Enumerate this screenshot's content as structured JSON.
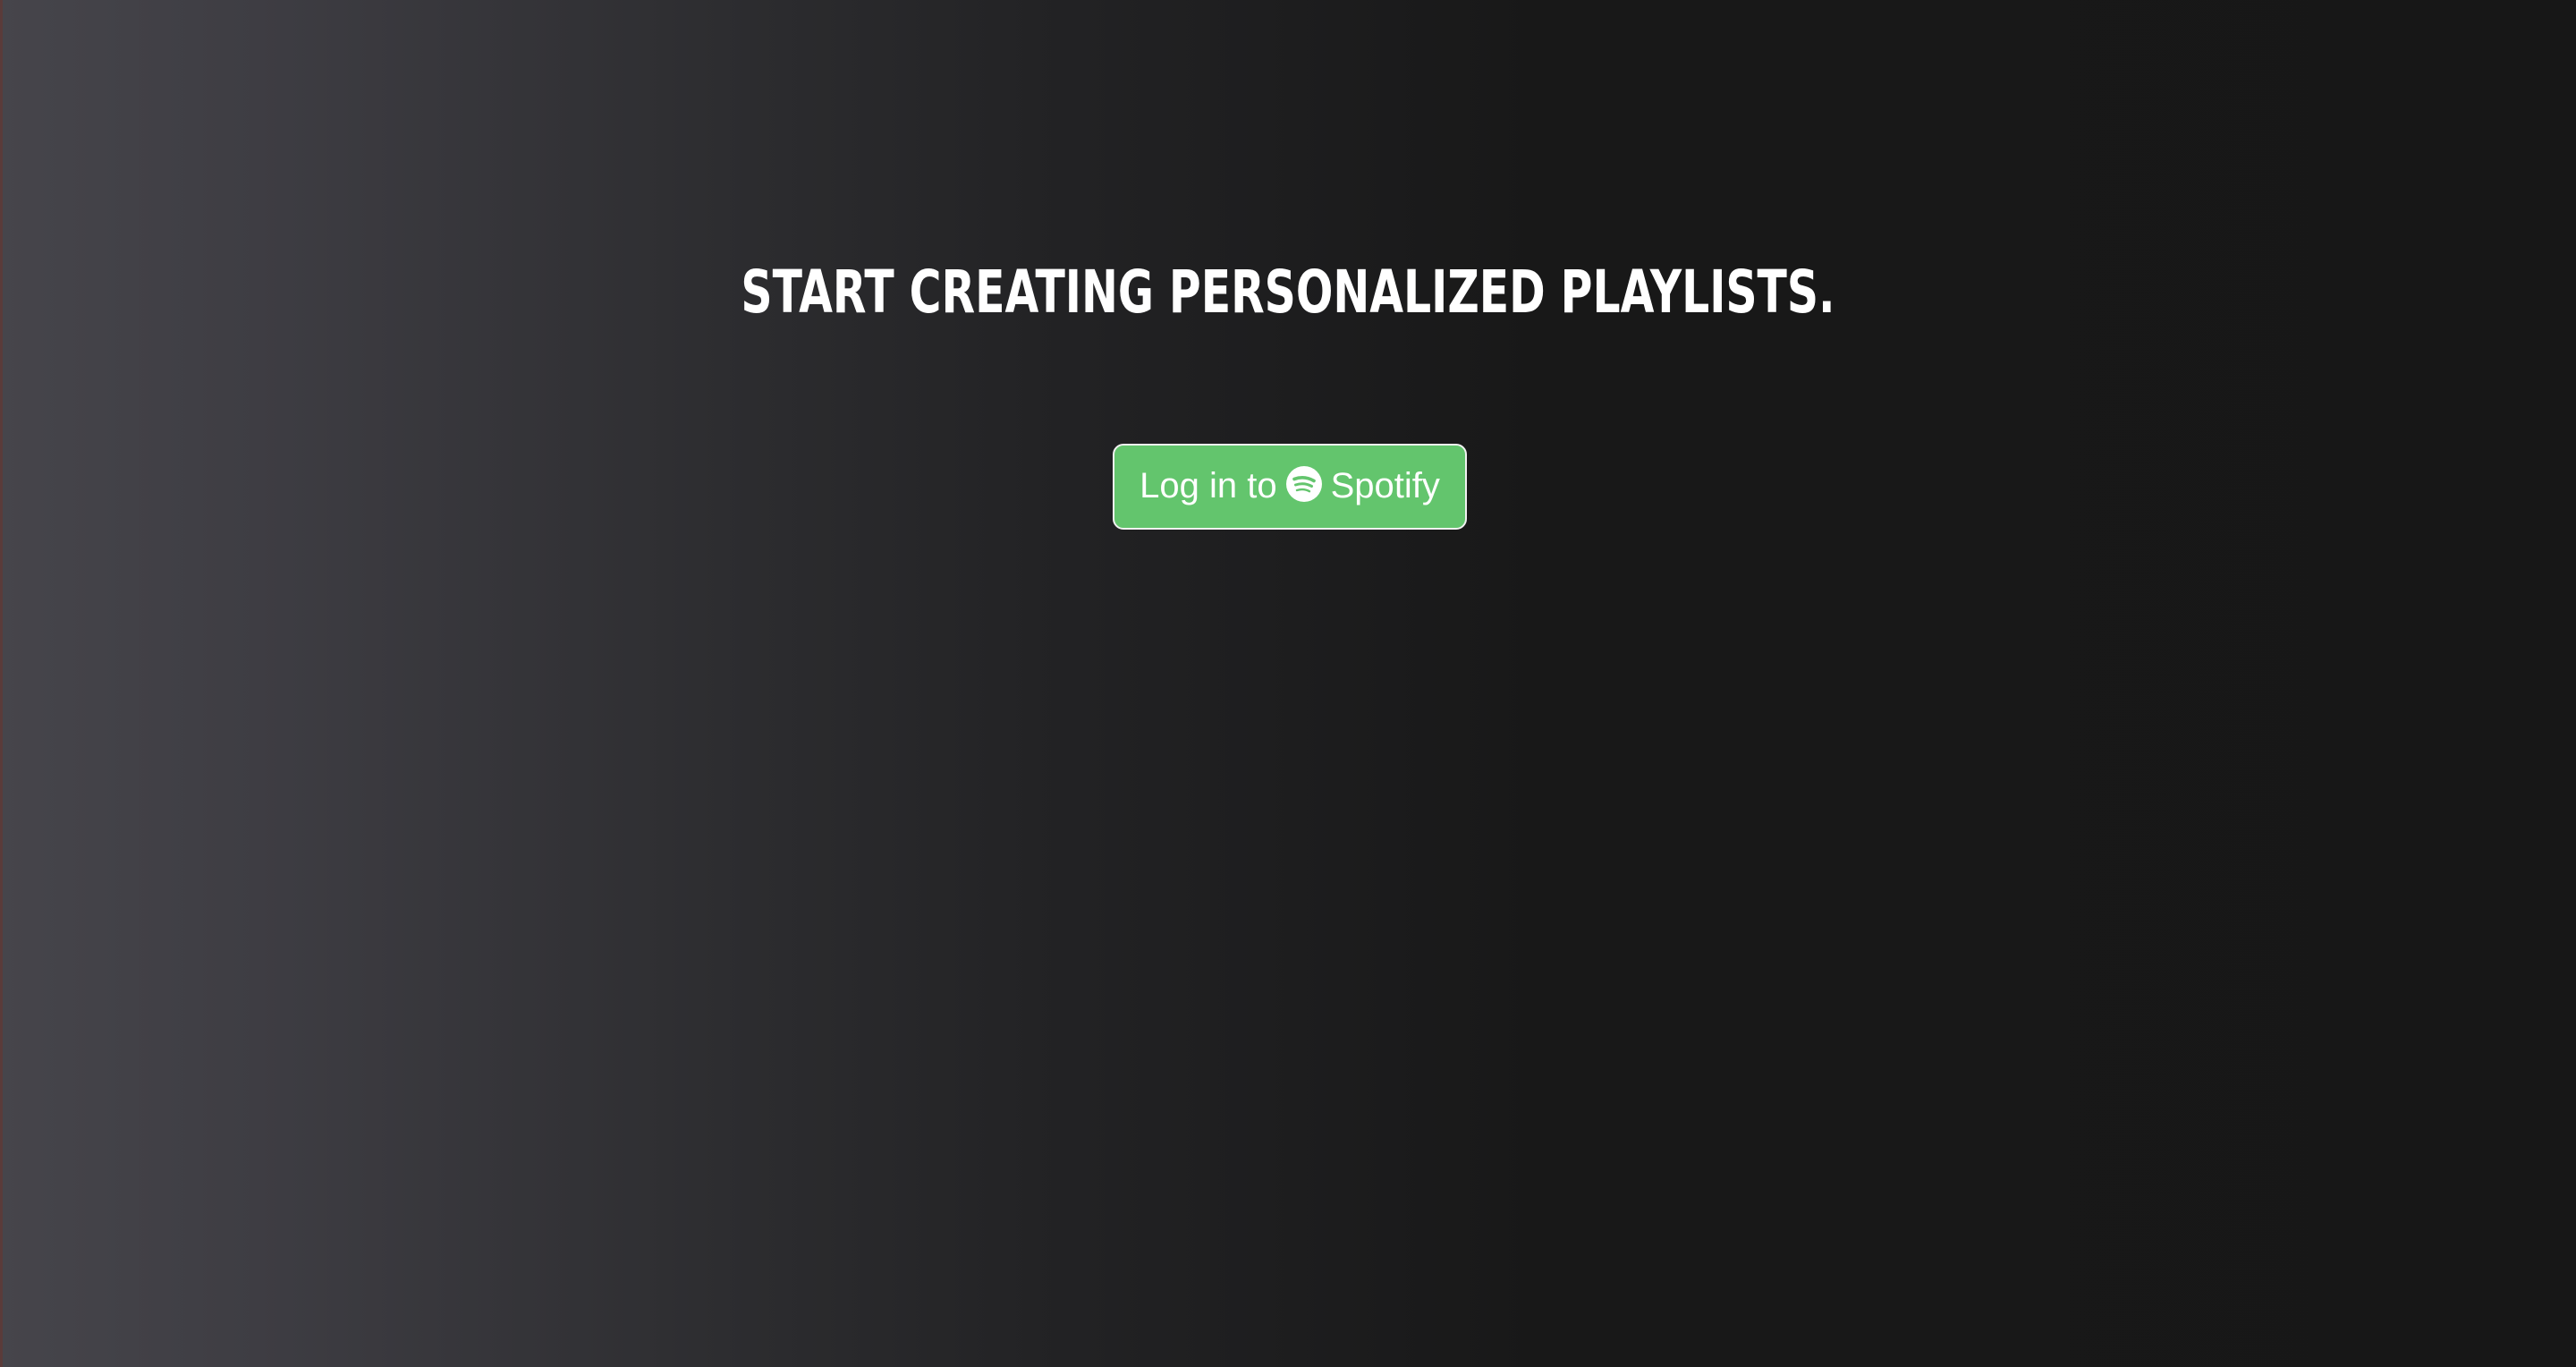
{
  "main": {
    "headline": "Start creating personalized playlists.",
    "login_button": {
      "prefix": "Log in to",
      "brand": "Spotify",
      "brand_icon": "spotify-icon"
    }
  },
  "colors": {
    "accent": "#63c56d",
    "text": "#ffffff",
    "background_dark": "#171717",
    "background_light": "#46454b"
  }
}
